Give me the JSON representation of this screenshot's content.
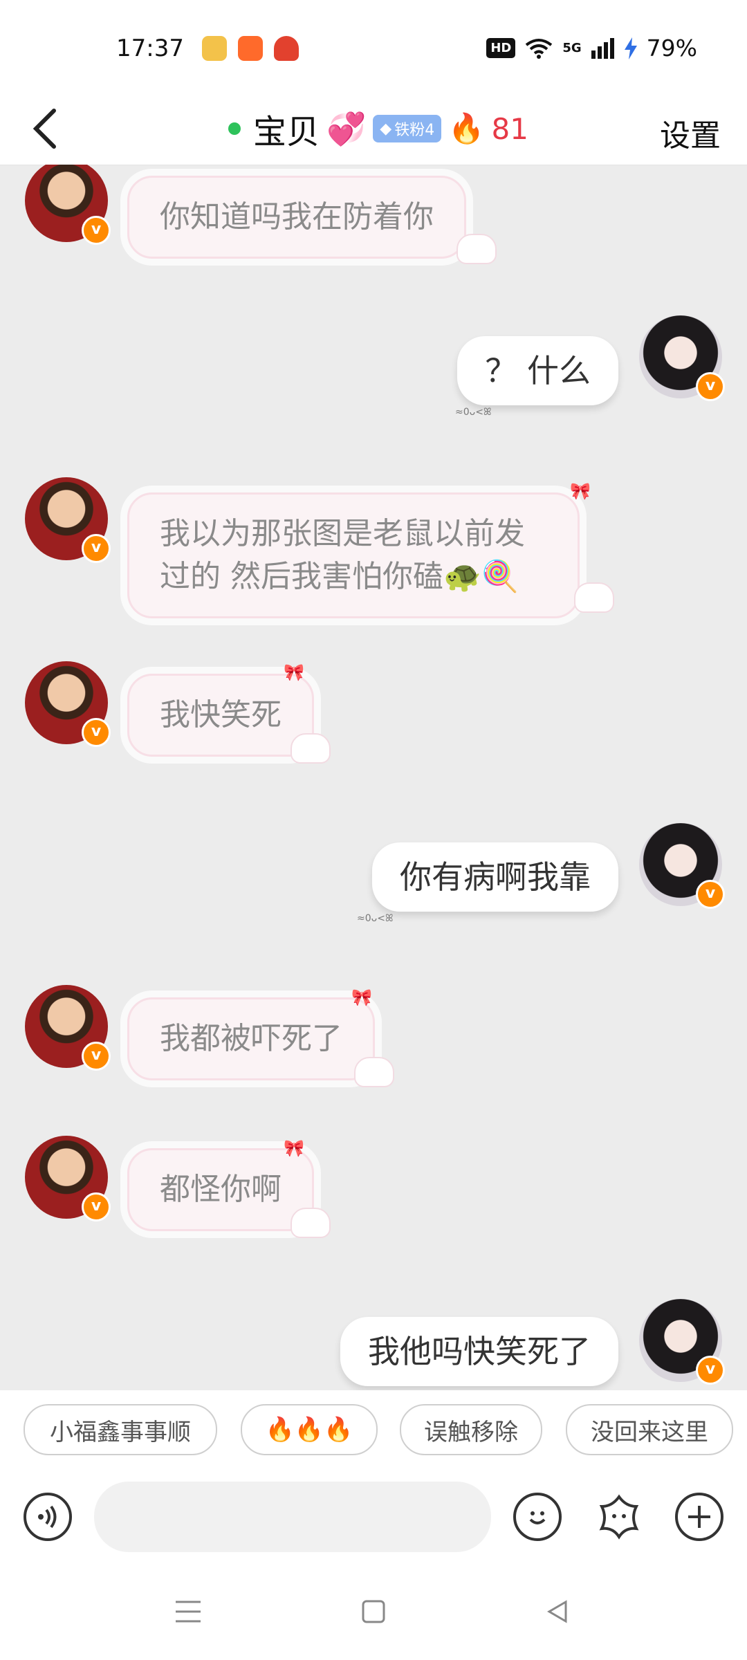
{
  "status_bar": {
    "time": "17:37",
    "hd_label": "HD",
    "network_label": "5G",
    "battery": "79%",
    "icons": [
      "weibo-icon",
      "app-icon-orange",
      "app-icon-red",
      "wifi-icon",
      "signal-icon",
      "charging-icon"
    ]
  },
  "header": {
    "title": "宝贝",
    "hearts_emoji": "💞",
    "fan_badge": "铁粉4",
    "fire_emoji": "🔥",
    "streak_count": "81",
    "settings_label": "设置"
  },
  "messages": [
    {
      "side": "left",
      "text": "你知道吗我在防着你"
    },
    {
      "side": "right",
      "text": "？ 什么",
      "tail": "≈0ᴗ<ꕤ"
    },
    {
      "side": "left",
      "text": "我以为那张图是老鼠以前发过的 然后我害怕你磕🐢🍭"
    },
    {
      "side": "left",
      "text": "我快笑死"
    },
    {
      "side": "right",
      "text": "你有病啊我靠",
      "tail": "≈0ᴗ<ꕤ"
    },
    {
      "side": "left",
      "text": "我都被吓死了"
    },
    {
      "side": "left",
      "text": "都怪你啊"
    },
    {
      "side": "right",
      "text": "我他吗快笑死了"
    }
  ],
  "quick_replies": [
    "小福鑫事事顺",
    "🔥🔥🔥",
    "误触移除",
    "没回来这里"
  ],
  "input": {
    "placeholder": ""
  },
  "colors": {
    "accent": "#ff8a00",
    "online": "#2ec25b",
    "streak": "#e63946"
  }
}
